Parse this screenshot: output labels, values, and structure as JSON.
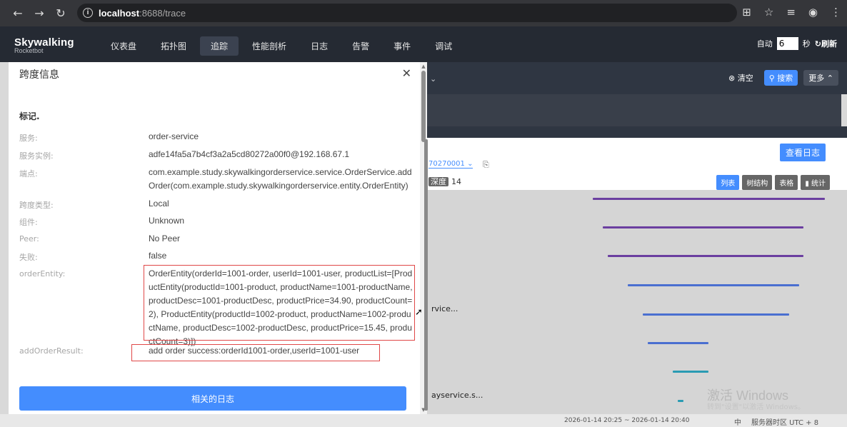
{
  "browser": {
    "url_host": "localhost",
    "url_rest": ":8688/trace"
  },
  "app": {
    "logo_main": "Skywalking",
    "logo_sub": "Rocketbot",
    "nav": [
      "仪表盘",
      "拓扑图",
      "追踪",
      "性能剖析",
      "日志",
      "告警",
      "事件",
      "调试"
    ],
    "active_nav": "追踪",
    "auto_label": "自动",
    "auto_value": "6",
    "seconds_label": "秒",
    "refresh_label": "刷新"
  },
  "toolbar": {
    "clear_label": "清空",
    "search_label": "搜索",
    "more_label": "更多"
  },
  "trace": {
    "view_log_label": "查看日志",
    "trace_id_partial": "70270001",
    "depth_label": "深度",
    "depth_value": "14",
    "tabs": [
      "列表",
      "树结构",
      "表格",
      "统计"
    ],
    "row_text_1": "rvice...",
    "row_text_2": "ayservice.s..."
  },
  "drawer": {
    "title": "跨度信息",
    "section": "标记.",
    "fields": [
      {
        "label": "服务:",
        "value": "order-service"
      },
      {
        "label": "服务实例:",
        "value": "adfe14fa5a7b4cf3a2a5cd80272a00f0@192.168.67.1"
      },
      {
        "label": "端点:",
        "value": "com.example.study.skywalkingorderservice.service.OrderService.addOrder(com.example.study.skywalkingorderservice.entity.OrderEntity)"
      },
      {
        "label": "跨度类型:",
        "value": "Local"
      },
      {
        "label": "组件:",
        "value": "Unknown"
      },
      {
        "label": "Peer:",
        "value": "No Peer"
      },
      {
        "label": "失败:",
        "value": "false"
      },
      {
        "label": "orderEntity:",
        "value": "OrderEntity(orderId=1001-order, userId=1001-user, productList=[ProductEntity(productId=1001-product, productName=1001-productName, productDesc=1001-productDesc, productPrice=34.90, productCount=2), ProductEntity(productId=1002-product, productName=1002-productName, productDesc=1002-productDesc, productPrice=15.45, productCount=3)])"
      },
      {
        "label": "addOrderResult:",
        "value": "add order success:orderId1001-order,userId=1001-user"
      }
    ],
    "related_log_label": "相关的日志"
  },
  "footer": {
    "time_range": "2026-01-14 20:25 ~ 2026-01-14 20:40",
    "lang": "中",
    "timezone": "服务器时区 UTC + 8"
  },
  "watermark": {
    "line1": "激活 Windows",
    "line2": "转到\"设置\"以激活 Windows。"
  },
  "colors": {
    "accent": "#448dfe",
    "header_bg": "#252a33",
    "highlight": "#e04848",
    "bar_purple": "#6b3fa0",
    "bar_blue": "#4a6fd0",
    "bar_teal": "#2a9bb3"
  }
}
